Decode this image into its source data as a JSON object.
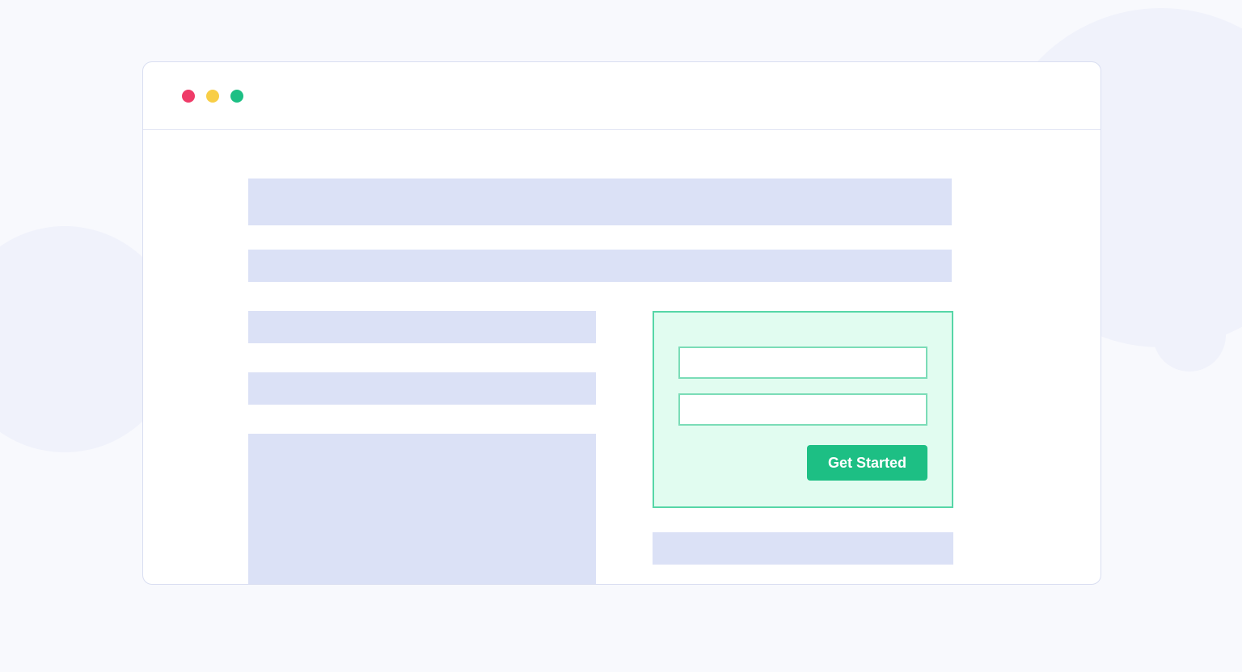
{
  "colors": {
    "dot_red": "#ef3b68",
    "dot_yellow": "#f8ce46",
    "dot_green": "#1dbf84",
    "placeholder": "#dbe1f6",
    "panel_bg": "#e1fcf0",
    "panel_border": "#56d6a7",
    "input_border": "#7bdcb7",
    "button_bg": "#1dbf84"
  },
  "form": {
    "field1_value": "",
    "field2_value": "",
    "field1_placeholder": "",
    "field2_placeholder": "",
    "button_label": "Get Started"
  }
}
